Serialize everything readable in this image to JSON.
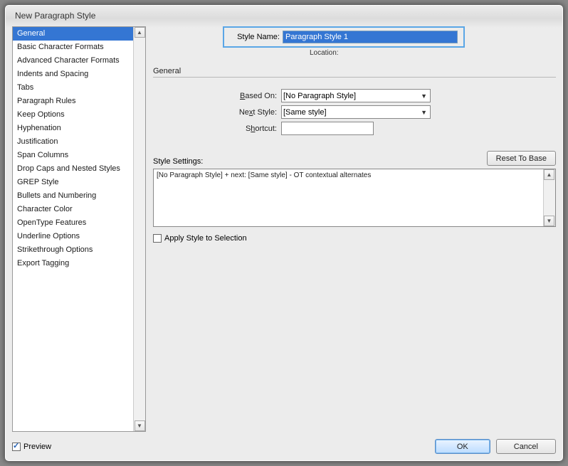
{
  "window": {
    "title": "New Paragraph Style"
  },
  "sidebar": {
    "items": [
      "General",
      "Basic Character Formats",
      "Advanced Character Formats",
      "Indents and Spacing",
      "Tabs",
      "Paragraph Rules",
      "Keep Options",
      "Hyphenation",
      "Justification",
      "Span Columns",
      "Drop Caps and Nested Styles",
      "GREP Style",
      "Bullets and Numbering",
      "Character Color",
      "OpenType Features",
      "Underline Options",
      "Strikethrough Options",
      "Export Tagging"
    ],
    "selected_index": 0
  },
  "header": {
    "style_name_label": "Style Name:",
    "style_name_value": "Paragraph Style 1",
    "location_label": "Location:"
  },
  "section": {
    "title": "General"
  },
  "form": {
    "based_on_label": "Based On:",
    "based_on_value": "[No Paragraph Style]",
    "next_style_label": "Next Style:",
    "next_style_value": "[Same style]",
    "shortcut_label": "Shortcut:",
    "shortcut_value": ""
  },
  "settings": {
    "label": "Style Settings:",
    "reset_button": "Reset To Base",
    "summary": "[No Paragraph Style] + next: [Same style] - OT contextual alternates"
  },
  "apply": {
    "label": "Apply Style to Selection",
    "checked": false
  },
  "footer": {
    "preview_label": "Preview",
    "preview_checked": true,
    "ok": "OK",
    "cancel": "Cancel"
  }
}
